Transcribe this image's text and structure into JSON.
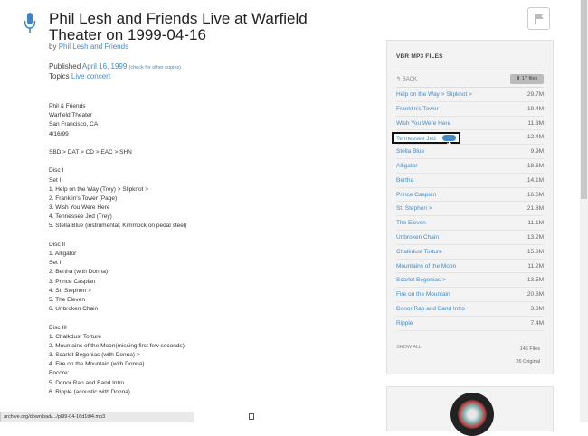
{
  "header": {
    "title": "Phil Lesh and Friends Live at Warfield Theater on 1999-04-16",
    "by_prefix": "by",
    "by_link": "Phil Lesh and Friends",
    "published_label": "Published",
    "published_date": "April 16, 1999",
    "check_other": "(check for other copies)",
    "topics_label": "Topics",
    "topics_value": "Live concert"
  },
  "description": [
    "Phil & Friends",
    "Warfield Theater",
    "San Francisco, CA",
    "4/16/99",
    "",
    "SBD > DAT > CD > EAC > SHN",
    "",
    "Disc I",
    "Set I",
    "1. Help on the Way (Trey) > Slipknot >",
    "2. Franklin's Tower (Page)",
    "3. Wish You Were Here",
    "4. Tennessee Jed (Trey)",
    "5. Stella Blue (instrumental; Kimmock on pedal steel)",
    "",
    "Disc II",
    "1. Alligator",
    "Set II",
    "2. Bertha (with Donna)",
    "3. Prince Caspian",
    "4. St. Stephen >",
    "5. The Eleven",
    "6. Unbroken Chain",
    "",
    "Disc III",
    "1. Chalkdust Torture",
    "2. Mountains of the Moon(missing first few seconds)",
    "3. Scarlet Begonias (with Donna) >",
    "4. Fire on the Mountain (with Donna)",
    "Encore:",
    "5. Donor Rap and Band Intro",
    "6. Ripple (acoustic with Donna)"
  ],
  "panel": {
    "title": "VBR MP3 FILES",
    "back": "BACK",
    "files_badge": "17 files",
    "tracks": [
      {
        "name": "Help on the Way > Slipknot >",
        "size": "29.7M"
      },
      {
        "name": "Franklin's Tower",
        "size": "19.4M"
      },
      {
        "name": "Wish You Were Here",
        "size": "11.3M"
      },
      {
        "name": "Tennessee Jed",
        "size": "12.4M"
      },
      {
        "name": "Stella Blue",
        "size": "9.9M"
      },
      {
        "name": "Alligator",
        "size": "18.6M"
      },
      {
        "name": "Bertha",
        "size": "14.1M"
      },
      {
        "name": "Prince Caspian",
        "size": "16.6M"
      },
      {
        "name": "St. Stephen >",
        "size": "21.8M"
      },
      {
        "name": "The Eleven",
        "size": "11.1M"
      },
      {
        "name": "Unbroken Chain",
        "size": "13.2M"
      },
      {
        "name": "Chalkdust Torture",
        "size": "15.8M"
      },
      {
        "name": "Mountains of the Moon",
        "size": "11.2M"
      },
      {
        "name": "Scarlet Begonias >",
        "size": "13.5M"
      },
      {
        "name": "Fire on the Mountain",
        "size": "20.6M"
      },
      {
        "name": "Donor Rap and Band Intro",
        "size": "3.8M"
      },
      {
        "name": "Ripple",
        "size": "7.4M"
      }
    ],
    "highlight_name": "Tennessee Jed",
    "show_all": "SHOW ALL",
    "total_files": "145 Files",
    "original": "26 Original"
  },
  "status_bar": "archive.org/download/.../pl99-04-16d1t04.mp3",
  "colors": {
    "accent": "#428bca",
    "mic": "#3b86c6"
  }
}
